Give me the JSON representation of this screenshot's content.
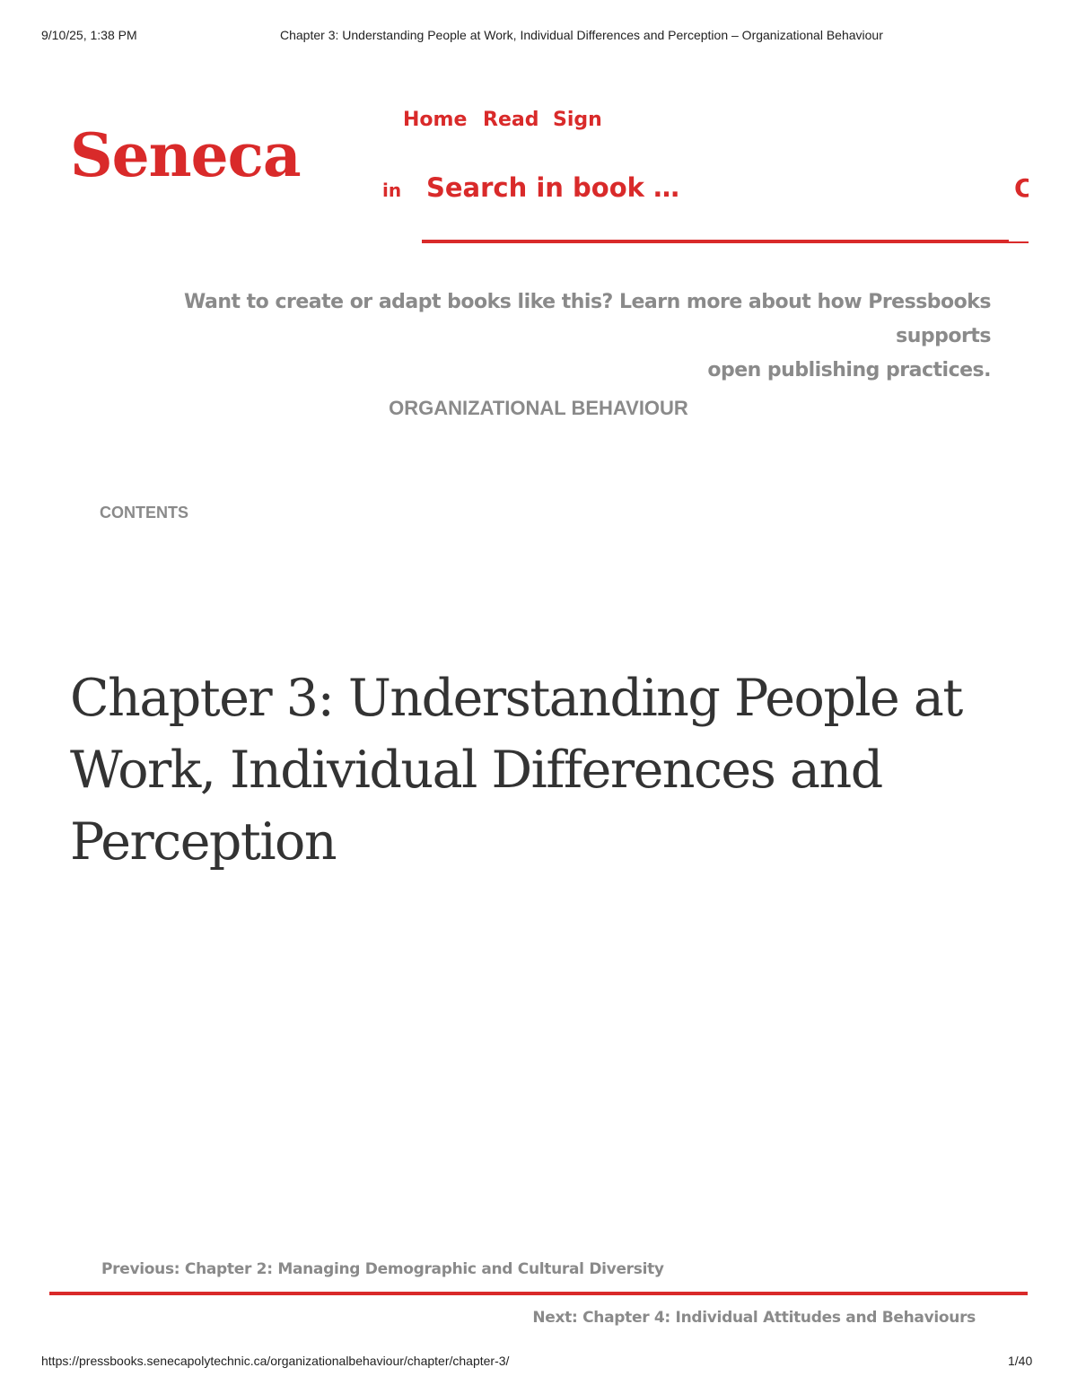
{
  "print_header": {
    "datetime": "9/10/25, 1:38 PM",
    "doc_title": "Chapter 3: Understanding People at Work, Individual Differences and Perception – Organizational Behaviour"
  },
  "brand": {
    "logo_text": "Seneca",
    "accent_color": "#d92a2a"
  },
  "nav": {
    "home": "Home",
    "read": "Read",
    "sign": "Sign",
    "in": "in"
  },
  "search": {
    "placeholder": "Search in book …",
    "submit_glyph": "C"
  },
  "promo": {
    "line1": "Want to create or adapt books like this? Learn more about how Pressbooks supports",
    "line2": "open publishing practices."
  },
  "book": {
    "title": "ORGANIZATIONAL BEHAVIOUR",
    "contents_label": "CONTENTS"
  },
  "chapter": {
    "title": "Chapter 3: Understanding People at Work, Individual Differences and Perception"
  },
  "pagination": {
    "previous": "Previous: Chapter 2: Managing Demographic and Cultural Diversity",
    "next": "Next: Chapter 4: Individual Attitudes and Behaviours"
  },
  "print_footer": {
    "url": "https://pressbooks.senecapolytechnic.ca/organizationalbehaviour/chapter/chapter-3/",
    "page": "1/40"
  }
}
